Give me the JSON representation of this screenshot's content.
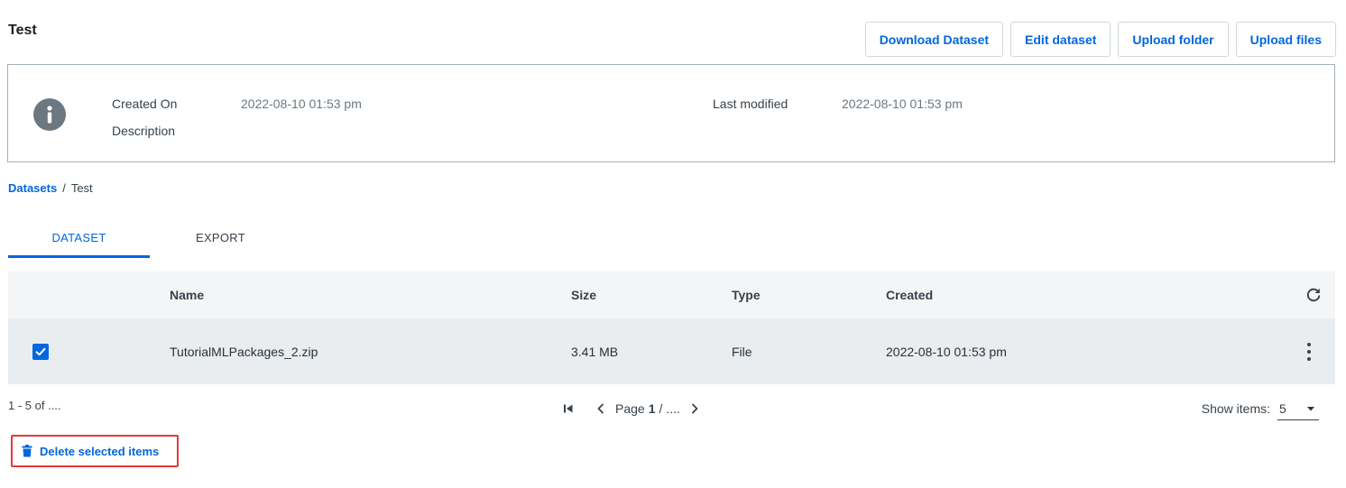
{
  "header": {
    "title": "Test",
    "actions": {
      "download": "Download Dataset",
      "edit": "Edit dataset",
      "upload_folder": "Upload folder",
      "upload_files": "Upload files"
    }
  },
  "info": {
    "created_on_label": "Created On",
    "created_on_value": "2022-08-10 01:53 pm",
    "description_label": "Description",
    "last_modified_label": "Last modified",
    "last_modified_value": "2022-08-10 01:53 pm"
  },
  "breadcrumb": {
    "root": "Datasets",
    "separator": "/",
    "current": "Test"
  },
  "tabs": [
    {
      "label": "DATASET",
      "active": true
    },
    {
      "label": "EXPORT",
      "active": false
    }
  ],
  "table": {
    "columns": {
      "name": "Name",
      "size": "Size",
      "type": "Type",
      "created": "Created"
    },
    "rows": [
      {
        "checked": true,
        "name": "TutorialMLPackages_2.zip",
        "size": "3.41 MB",
        "type": "File",
        "created": "2022-08-10 01:53 pm"
      }
    ]
  },
  "pagination": {
    "range": "1 - 5 of ....",
    "page_label": "Page",
    "page_current": "1",
    "page_sep": "/",
    "page_total": "....",
    "show_items_label": "Show items:",
    "show_items_value": "5"
  },
  "footer": {
    "delete_label": "Delete selected items"
  },
  "colors": {
    "accent": "#0067df",
    "highlight_border": "#e2393e"
  },
  "icons": {
    "info": "info-icon",
    "refresh": "refresh-icon",
    "more": "more-vertical-icon",
    "checkbox": "check-icon",
    "first_page": "first-page-icon",
    "prev_page": "chevron-left-icon",
    "next_page": "chevron-right-icon",
    "dropdown": "caret-down-icon",
    "delete": "trash-icon"
  }
}
